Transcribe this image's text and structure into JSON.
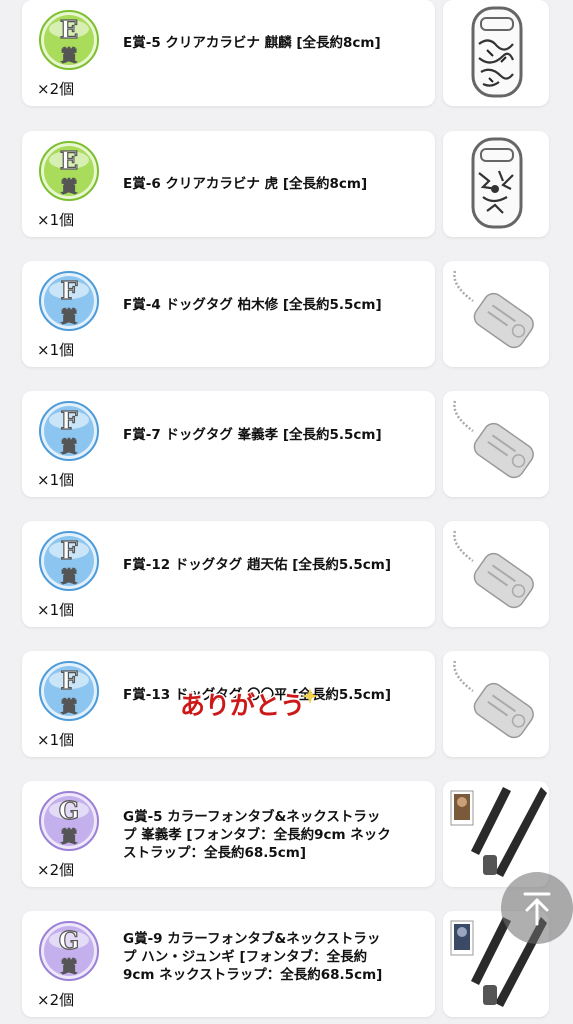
{
  "colors": {
    "E": "#8fcf3a",
    "F": "#6db2e8",
    "G": "#b59be0",
    "thanks": "#cc1818"
  },
  "items": [
    {
      "grade": "E",
      "badge_letter": "E",
      "badge_kanji": "賞",
      "name": "E賞-5 クリアカラビナ 麒麟 [全長約8cm]",
      "qty": "×2個",
      "thumb_icon": "clear-carabiner-kirin-image"
    },
    {
      "grade": "E",
      "badge_letter": "E",
      "badge_kanji": "賞",
      "name": "E賞-6 クリアカラビナ 虎 [全長約8cm]",
      "qty": "×1個",
      "thumb_icon": "clear-carabiner-tiger-image"
    },
    {
      "grade": "F",
      "badge_letter": "F",
      "badge_kanji": "賞",
      "name": "F賞-4 ドッグタグ 柏木修 [全長約5.5cm]",
      "qty": "×1個",
      "thumb_icon": "dog-tag-image"
    },
    {
      "grade": "F",
      "badge_letter": "F",
      "badge_kanji": "賞",
      "name": "F賞-7 ドッグタグ 峯義孝 [全長約5.5cm]",
      "qty": "×1個",
      "thumb_icon": "dog-tag-image"
    },
    {
      "grade": "F",
      "badge_letter": "F",
      "badge_kanji": "賞",
      "name": "F賞-12 ドッグタグ 趙天佑 [全長約5.5cm]",
      "qty": "×1個",
      "thumb_icon": "dog-tag-image"
    },
    {
      "grade": "F",
      "badge_letter": "F",
      "badge_kanji": "賞",
      "name": "F賞-13 ドッグタグ 〇〇平 [全長約5.5cm]",
      "qty": "×1個",
      "thumb_icon": "dog-tag-image"
    },
    {
      "grade": "G",
      "badge_letter": "G",
      "badge_kanji": "賞",
      "name": "G賞-5 カラーフォンタブ&ネックストラップ 峯義孝 [フォンタブ：全長約9cm ネックストラップ：全長約68.5cm]",
      "qty": "×2個",
      "thumb_icon": "phone-tab-strap-image"
    },
    {
      "grade": "G",
      "badge_letter": "G",
      "badge_kanji": "賞",
      "name": "G賞-9 カラーフォンタブ&ネックストラップ ハン・ジュンギ [フォンタブ：全長約9cm ネックストラップ：全長約68.5cm]",
      "qty": "×2個",
      "thumb_icon": "phone-tab-strap-image"
    }
  ],
  "overlay": {
    "thanks_text": "ありがとう"
  },
  "controls": {
    "scroll_top_icon": "arrow-up-to-top-icon"
  }
}
